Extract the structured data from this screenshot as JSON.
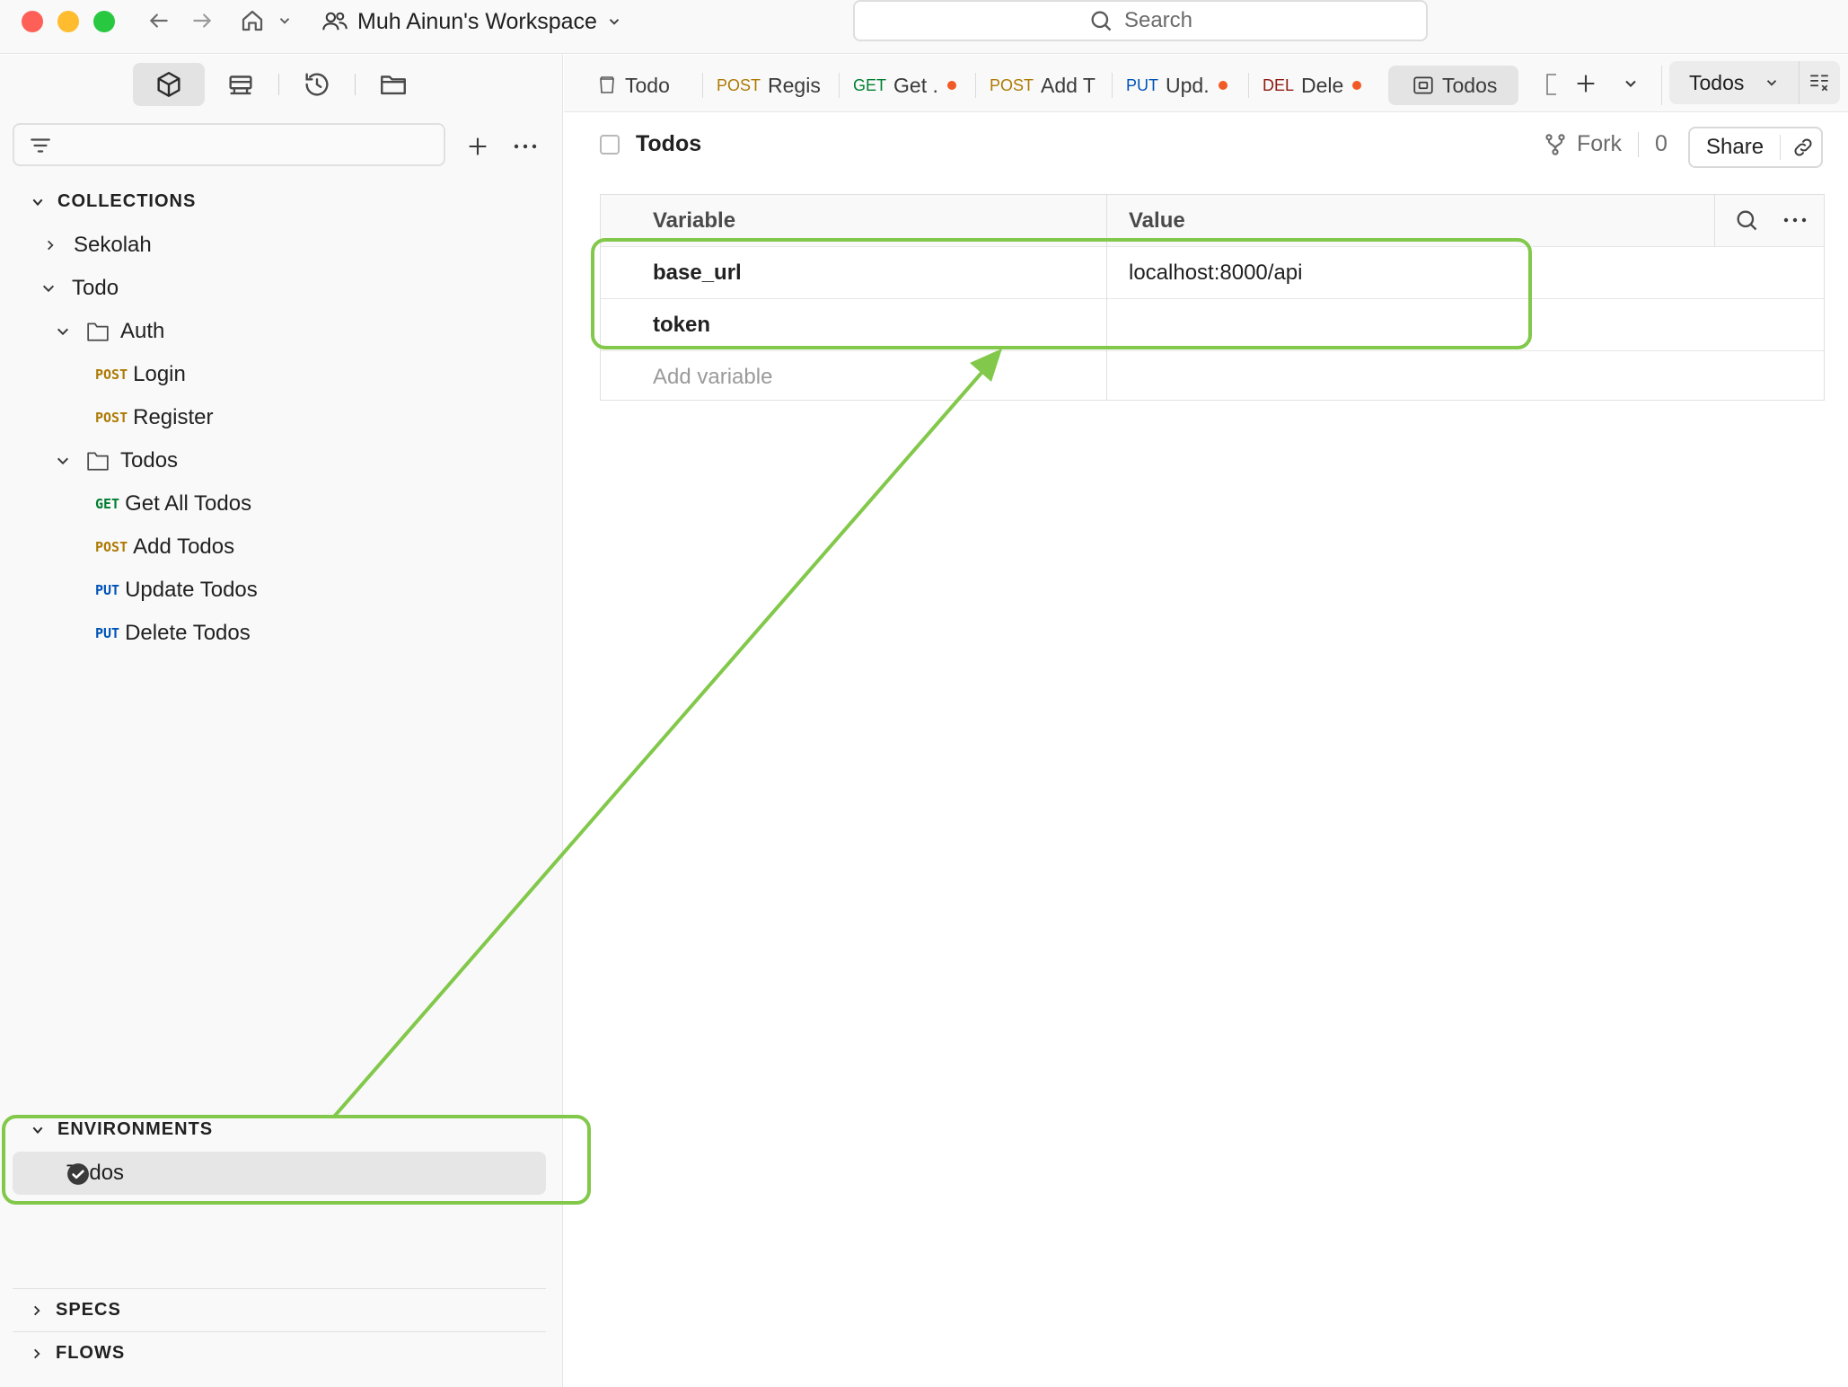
{
  "topbar": {
    "workspace_name": "Muh Ainun's Workspace",
    "search_placeholder": "Search"
  },
  "sidebar": {
    "collections_title": "COLLECTIONS",
    "tree": [
      {
        "label": "Sekolah"
      },
      {
        "label": "Todo"
      },
      {
        "label": "Auth"
      },
      {
        "method": "POST",
        "label": "Login"
      },
      {
        "method": "POST",
        "label": "Register"
      },
      {
        "label": "Todos"
      },
      {
        "method": "GET",
        "label": "Get All Todos"
      },
      {
        "method": "POST",
        "label": "Add Todos"
      },
      {
        "method": "PUT",
        "label": "Update Todos"
      },
      {
        "method": "PUT",
        "label": "Delete Todos"
      }
    ],
    "environments_title": "ENVIRONMENTS",
    "environment_active": "Todos",
    "specs_title": "SPECS",
    "flows_title": "FLOWS"
  },
  "tabs": [
    {
      "method": "",
      "label": "Todo"
    },
    {
      "method": "POST",
      "label": "Regis"
    },
    {
      "method": "GET",
      "label": "Get ."
    },
    {
      "method": "POST",
      "label": "Add T"
    },
    {
      "method": "PUT",
      "label": "Upd."
    },
    {
      "method": "DEL",
      "label": "Dele"
    },
    {
      "method": "",
      "label": "Todos"
    }
  ],
  "env_select": {
    "value": "Todos"
  },
  "main": {
    "title": "Todos",
    "fork_label": "Fork",
    "fork_count": "0",
    "share_label": "Share",
    "table": {
      "headers": [
        "Variable",
        "Value"
      ],
      "rows": [
        {
          "variable": "base_url",
          "value": "localhost:8000/api"
        },
        {
          "variable": "token",
          "value": ""
        }
      ],
      "add_placeholder": "Add variable"
    }
  },
  "colors": {
    "annotation": "#82c84a",
    "post": "#ad7a03",
    "get": "#007f31",
    "put": "#0053b8",
    "del": "#8e1a10",
    "unsaved_dot": "#f15a24"
  }
}
